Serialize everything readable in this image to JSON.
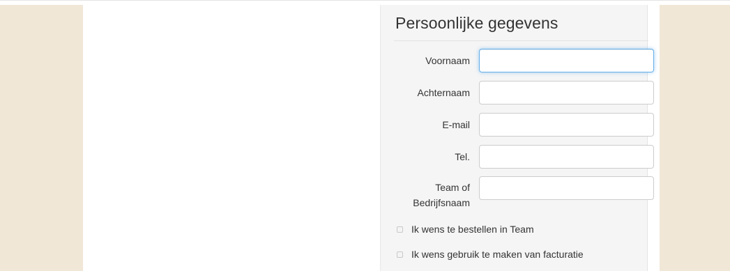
{
  "section": {
    "title": "Persoonlijke gegevens"
  },
  "form": {
    "fields": [
      {
        "label": "Voornaam",
        "value": "",
        "placeholder": ""
      },
      {
        "label": "Achternaam",
        "value": "",
        "placeholder": ""
      },
      {
        "label": "E-mail",
        "value": "",
        "placeholder": ""
      },
      {
        "label": "Tel.",
        "value": "",
        "placeholder": ""
      },
      {
        "label_line1": "Team of",
        "label_line2": "Bedrijfsnaam",
        "value": "",
        "placeholder": ""
      }
    ],
    "checkboxes": [
      {
        "label": "Ik wens te bestellen in Team",
        "checked": false
      },
      {
        "label": "Ik wens gebruik te maken van facturatie",
        "checked": false
      }
    ]
  },
  "colors": {
    "page_margin": "#f1e7d7",
    "panel_background": "#f5f5f5",
    "focus_border": "#66afe9"
  }
}
